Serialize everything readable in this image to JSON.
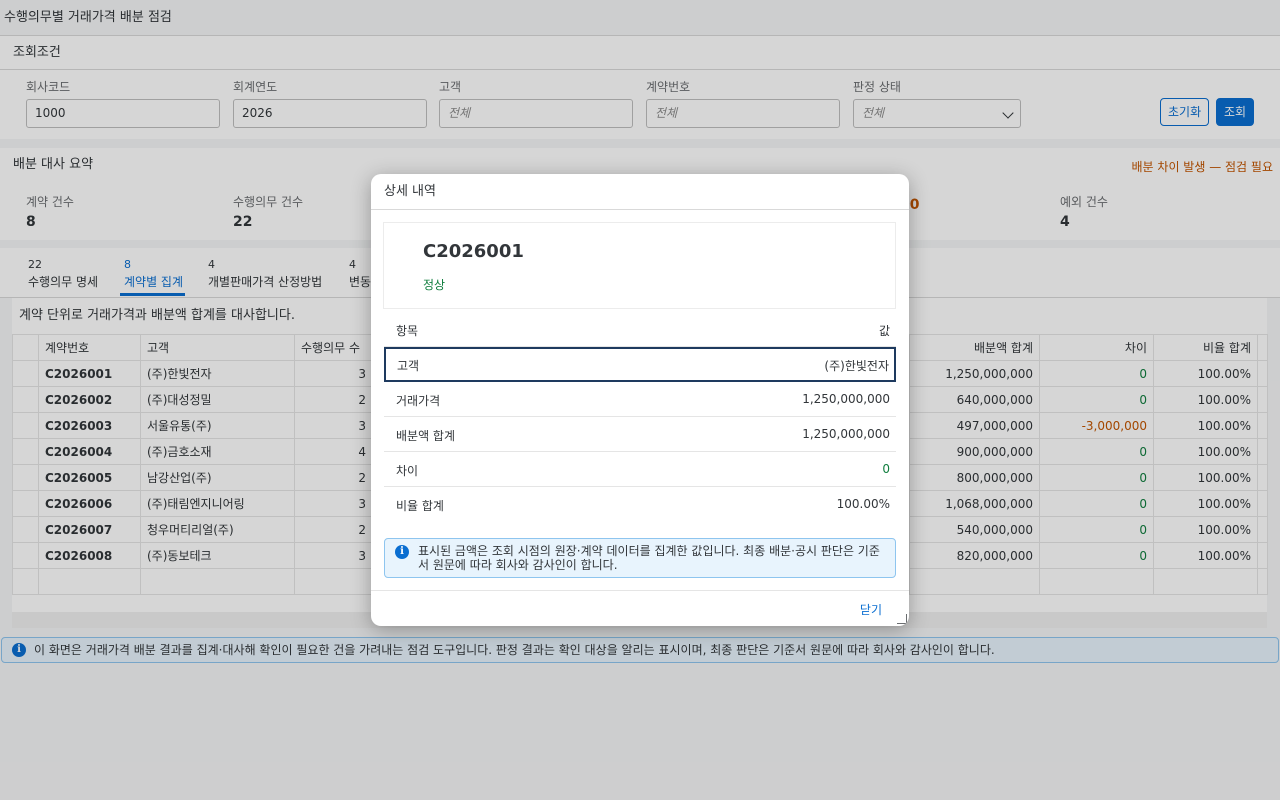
{
  "page": {
    "title": "수행의무별 거래가격 배분 점검"
  },
  "filters": {
    "heading": "조회조건",
    "company_code": {
      "label": "회사코드",
      "value": "1000"
    },
    "fiscal_year": {
      "label": "회계연도",
      "value": "2026"
    },
    "customer": {
      "label": "고객",
      "placeholder": "전체"
    },
    "contract_no": {
      "label": "계약번호",
      "placeholder": "전체"
    },
    "status": {
      "label": "판정 상태",
      "value": "전체"
    },
    "reset_label": "초기화",
    "search_label": "조회"
  },
  "summary": {
    "heading": "배분 대사 요약",
    "warning": "배분 차이 발생 — 점검 필요",
    "kpis": [
      {
        "label": "계약 건수",
        "value": "8"
      },
      {
        "label": "수행의무 건수",
        "value": "22"
      },
      {
        "label": "",
        "value": "00"
      },
      {
        "label": "예외 건수",
        "value": "4"
      }
    ]
  },
  "tabs": [
    {
      "count": "22",
      "label": "수행의무 명세"
    },
    {
      "count": "8",
      "label": "계약별 집계"
    },
    {
      "count": "4",
      "label": "개별판매가격 산정방법"
    },
    {
      "count": "4",
      "label": "변동"
    }
  ],
  "table": {
    "caption": "계약 단위로 거래가격과 배분액 합계를 대사합니다.",
    "columns": [
      "계약번호",
      "고객",
      "수행의무 수",
      "배분액 합계",
      "차이",
      "비율 합계"
    ],
    "rows": [
      {
        "id": "C2026001",
        "customer": "(주)한빛전자",
        "count": "3",
        "alloc": "1,250,000,000",
        "diff": "0",
        "ratio": "100.00%"
      },
      {
        "id": "C2026002",
        "customer": "(주)대성정밀",
        "count": "2",
        "alloc": "640,000,000",
        "diff": "0",
        "ratio": "100.00%"
      },
      {
        "id": "C2026003",
        "customer": "서울유통(주)",
        "count": "3",
        "alloc": "497,000,000",
        "diff": "-3,000,000",
        "ratio": "100.00%"
      },
      {
        "id": "C2026004",
        "customer": "(주)금호소재",
        "count": "4",
        "alloc": "900,000,000",
        "diff": "0",
        "ratio": "100.00%"
      },
      {
        "id": "C2026005",
        "customer": "남강산업(주)",
        "count": "2",
        "alloc": "800,000,000",
        "diff": "0",
        "ratio": "100.00%"
      },
      {
        "id": "C2026006",
        "customer": "(주)태림엔지니어링",
        "count": "3",
        "alloc": "1,068,000,000",
        "diff": "0",
        "ratio": "100.00%"
      },
      {
        "id": "C2026007",
        "customer": "청우머티리얼(주)",
        "count": "2",
        "alloc": "540,000,000",
        "diff": "0",
        "ratio": "100.00%"
      },
      {
        "id": "C2026008",
        "customer": "(주)동보테크",
        "count": "3",
        "alloc": "820,000,000",
        "diff": "0",
        "ratio": "100.00%"
      }
    ]
  },
  "info_bar": "이 화면은 거래가격 배분 결과를 집계·대사해 확인이 필요한 건을 가려내는 점검 도구입니다. 판정 결과는 확인 대상을 알리는 표시이며, 최종 판단은 기준서 원문에 따라 회사와 감사인이 합니다.",
  "dialog": {
    "title": "상세 내역",
    "contract_id": "C2026001",
    "status": "정상",
    "header": {
      "key": "항목",
      "value": "값"
    },
    "rows": [
      {
        "key": "고객",
        "value": "(주)한빛전자"
      },
      {
        "key": "거래가격",
        "value": "1,250,000,000"
      },
      {
        "key": "배분액 합계",
        "value": "1,250,000,000"
      },
      {
        "key": "차이",
        "value": "0"
      },
      {
        "key": "비율 합계",
        "value": "100.00%"
      }
    ],
    "note": "표시된 금액은 조회 시점의 원장·계약 데이터를 집계한 값입니다. 최종 배분·공시 판단은 기준서 원문에 따라 회사와 감사인이 합니다.",
    "close_label": "닫기"
  },
  "colors": {
    "accent": "#0a6ed1",
    "positive": "#107e3e",
    "negative": "#c35500"
  }
}
